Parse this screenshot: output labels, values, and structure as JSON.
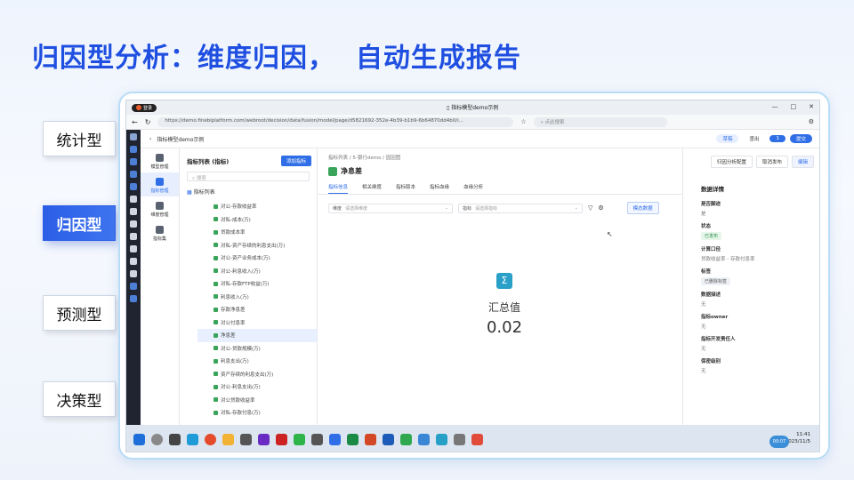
{
  "slide": {
    "title": "归因型分析：维度归因，  自动生成报告",
    "side_tabs": [
      {
        "label": "统计型",
        "active": false
      },
      {
        "label": "归因型",
        "active": true
      },
      {
        "label": "预测型",
        "active": false
      },
      {
        "label": "决策型",
        "active": false
      }
    ]
  },
  "browser": {
    "login_label": "登录",
    "tab_title": "指标模型demo示例",
    "url": "https://demo.finebiplatform.com/webroot/decision/data/fusion/model/page/d5821692-352e-4b39-b1b9-6b64870dd4b0/i...",
    "search_placeholder": "点此搜索"
  },
  "app": {
    "breadcrumb": "指标模型demo示例",
    "header_buttons": {
      "draft": "草稿",
      "publish": "查出",
      "user": "1",
      "submit": "提交"
    },
    "nav": [
      {
        "label": "模型管理",
        "icon": "model-icon",
        "active": false
      },
      {
        "label": "指标管理",
        "icon": "metric-icon",
        "active": true
      },
      {
        "label": "维度管理",
        "icon": "dimension-icon",
        "active": false
      },
      {
        "label": "指标集",
        "icon": "metric-set-icon",
        "active": false
      }
    ],
    "tree": {
      "title": "指标列表 (指标)",
      "add_button": "添加指标",
      "search_placeholder": "搜索",
      "root": "指标列表",
      "items": [
        "对公-存款收益率",
        "对私-成本(万)",
        "贷款成本率",
        "对私-资产存续的利息支出(万)",
        "对公-资产业务成本(万)",
        "对公-利息收入(万)",
        "对私-存款FTP收益(万)",
        "利息收入(万)",
        "存款净息差",
        "对公付息率",
        "净息差",
        "对公-贷款规模(万)",
        "利息支出(万)",
        "资产存续的利息支出(万)",
        "对公-利息支出(万)",
        "对公贷款收益率",
        "对私-存款付息(万)"
      ],
      "selected_index": 10
    },
    "main": {
      "breadcrumb": "指标列表 / 5-银行demo / 因因图",
      "metric_name": "净息差",
      "tabs": [
        "指标信息",
        "相关维度",
        "指标版本",
        "指标血缘",
        "血缘分析"
      ],
      "active_tab": 0,
      "filter_dim_label": "维度",
      "filter_dim_placeholder": "请选择维度",
      "filter_metric_label": "指标",
      "filter_metric_placeholder": "请选择指标",
      "query_button": "模态数据",
      "summary_label": "汇总值",
      "summary_value": "0.02"
    },
    "right": {
      "buttons": [
        "归因分析配置",
        "取消发布",
        "编辑"
      ],
      "details_title": "数据详情",
      "fields": [
        {
          "key": "是否脚迹",
          "value": "是"
        },
        {
          "key": "状态",
          "tag": "已发布"
        },
        {
          "key": "计算口径",
          "value": "贷款收益率 - 存款付息率"
        },
        {
          "key": "标签",
          "tag2": "已删除标签"
        },
        {
          "key": "数据描述",
          "value": "无"
        },
        {
          "key": "指标owner",
          "value": "无"
        },
        {
          "key": "指标开发责任人",
          "value": "无"
        },
        {
          "key": "保密级别",
          "value": "无"
        }
      ]
    }
  },
  "taskbar": {
    "time": "11:41",
    "date": "2023/11/5",
    "badge": "00:07"
  }
}
